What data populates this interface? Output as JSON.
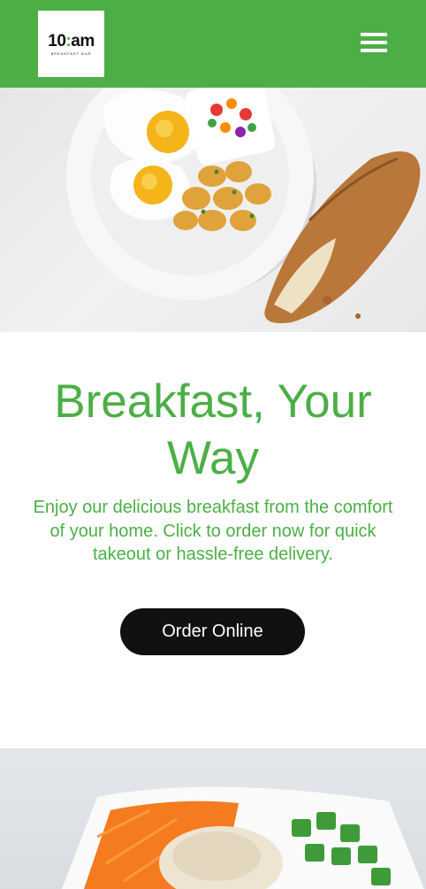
{
  "header": {
    "background_color": "#4caf46",
    "logo": {
      "main_left": "10",
      "main_dots": ":",
      "main_right": "am",
      "sub": "BREAKFAST BAR"
    },
    "menu_icon": "hamburger-menu-icon"
  },
  "hero_image": {
    "subject": "breakfast-plate-image"
  },
  "main": {
    "headline": "Breakfast, Your Way",
    "description": "Enjoy our delicious breakfast from the comfort of your home. Click to order now for quick takeout or hassle-free delivery.",
    "order_button_label": "Order Online",
    "accent_color": "#4caf46",
    "button_color": "#111111"
  },
  "second_image": {
    "subject": "salad-bowl-image"
  }
}
